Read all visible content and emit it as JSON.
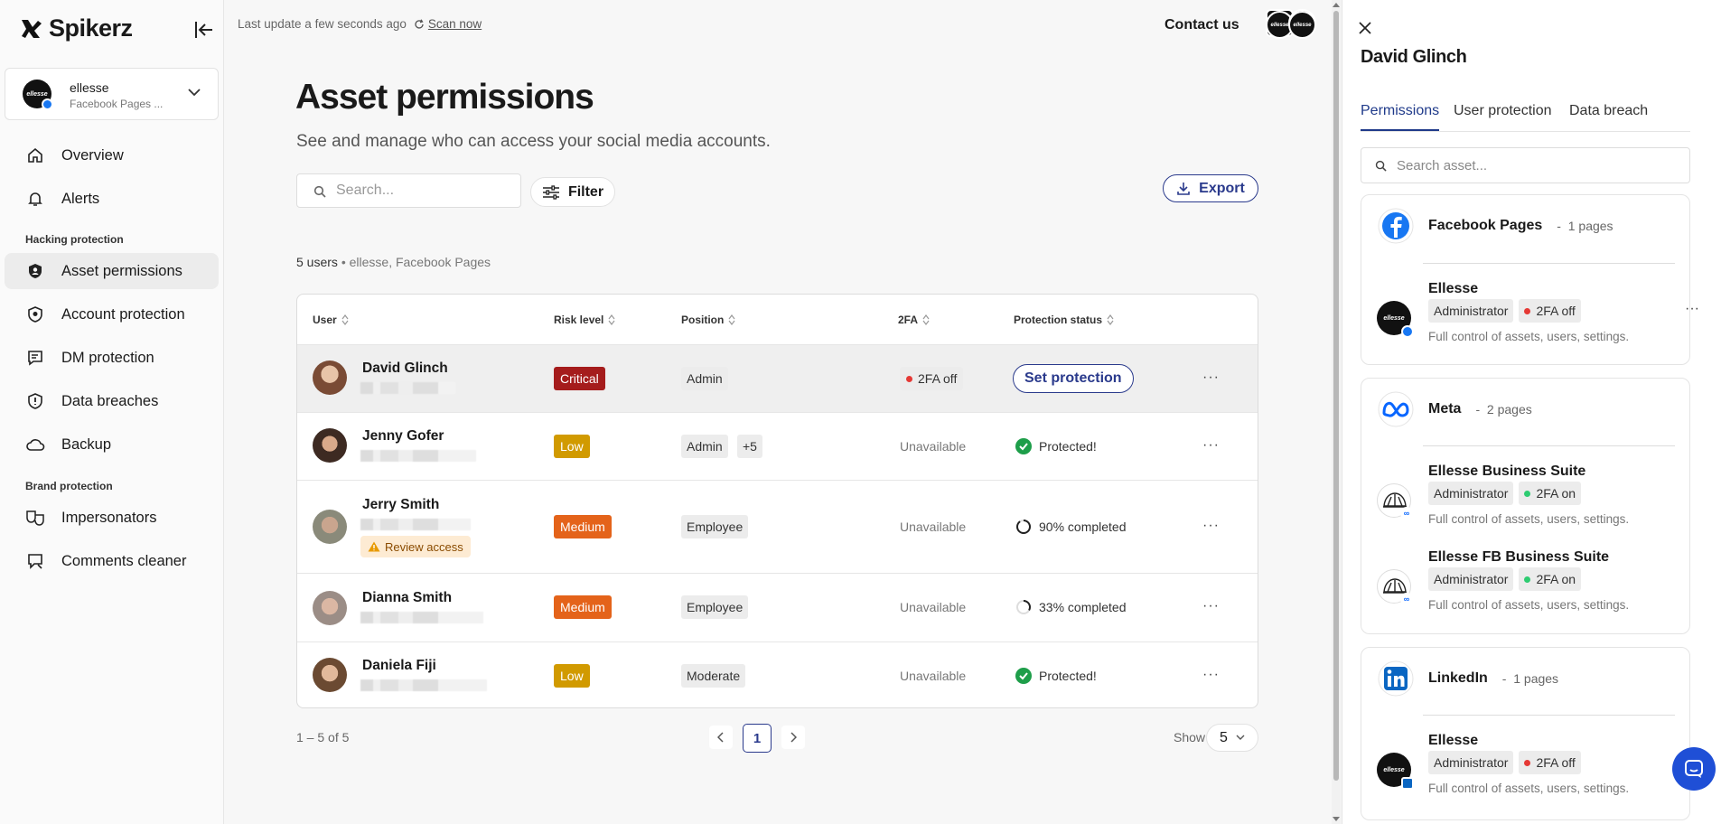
{
  "sidebar": {
    "brand": "Spikerz",
    "account": {
      "name": "ellesse",
      "subtitle": "Facebook Pages ...",
      "avatar_text": "ellesse"
    },
    "nav": [
      {
        "label": "Overview",
        "icon": "home-icon"
      },
      {
        "label": "Alerts",
        "icon": "bell-icon"
      }
    ],
    "section_hacking": "Hacking protection",
    "nav_hacking": [
      {
        "label": "Asset permissions",
        "icon": "shield-user-icon",
        "active": true
      },
      {
        "label": "Account protection",
        "icon": "shield-icon"
      },
      {
        "label": "DM protection",
        "icon": "message-icon"
      },
      {
        "label": "Data breaches",
        "icon": "shield-alert-icon"
      },
      {
        "label": "Backup",
        "icon": "cloud-icon"
      }
    ],
    "section_brand": "Brand protection",
    "nav_brand": [
      {
        "label": "Impersonators",
        "icon": "masks-icon"
      },
      {
        "label": "Comments cleaner",
        "icon": "comment-icon"
      }
    ]
  },
  "topbar": {
    "last_update": "Last update a few seconds ago",
    "scan_now": "Scan now",
    "contact": "Contact us"
  },
  "page": {
    "title": "Asset permissions",
    "subtitle": "See and manage who can access your social media accounts.",
    "search_placeholder": "Search...",
    "filter_label": "Filter",
    "export_label": "Export",
    "count_users": "5 users",
    "count_context": "ellesse, Facebook Pages"
  },
  "table": {
    "columns": [
      "User",
      "Risk level",
      "Position",
      "2FA",
      "Protection status"
    ],
    "rows": [
      {
        "name": "David Glinch",
        "risk": "Critical",
        "risk_color": "#a51c1c",
        "position": "Admin",
        "position_extra": "",
        "twofa": "2FA off",
        "status": "Set protection",
        "status_type": "action",
        "review": ""
      },
      {
        "name": "Jenny Gofer",
        "risk": "Low",
        "risk_color": "#d19a00",
        "position": "Admin",
        "position_extra": "+5",
        "twofa": "Unavailable",
        "status": "Protected!",
        "status_type": "protected",
        "review": ""
      },
      {
        "name": "Jerry Smith",
        "risk": "Medium",
        "risk_color": "#e4631a",
        "position": "Employee",
        "position_extra": "",
        "twofa": "Unavailable",
        "status": "90% completed",
        "status_type": "progress",
        "progress": 0.9,
        "review": "Review access"
      },
      {
        "name": "Dianna Smith",
        "risk": "Medium",
        "risk_color": "#e4631a",
        "position": "Employee",
        "position_extra": "",
        "twofa": "Unavailable",
        "status": "33% completed",
        "status_type": "progress",
        "progress": 0.33,
        "review": ""
      },
      {
        "name": "Daniela Fiji",
        "risk": "Low",
        "risk_color": "#d19a00",
        "position": "Moderate",
        "position_extra": "",
        "twofa": "Unavailable",
        "status": "Protected!",
        "status_type": "protected",
        "review": ""
      }
    ]
  },
  "pagination": {
    "range": "1 – 5 of 5",
    "current": "1",
    "show_label": "Show",
    "show_value": "5"
  },
  "panel": {
    "title": "David Glinch",
    "tabs": [
      "Permissions",
      "User protection",
      "Data breach"
    ],
    "active_tab": "Permissions",
    "search_placeholder": "Search asset...",
    "groups": [
      {
        "name": "Facebook Pages",
        "count": "1 pages",
        "icon": "facebook-icon",
        "assets": [
          {
            "name": "Ellesse",
            "role": "Administrator",
            "twofa": "2FA off",
            "twofa_on": false,
            "desc": "Full control of assets, users, settings."
          }
        ]
      },
      {
        "name": "Meta",
        "count": "2 pages",
        "icon": "meta-icon",
        "assets": [
          {
            "name": "Ellesse Business Suite",
            "role": "Administrator",
            "twofa": "2FA on",
            "twofa_on": true,
            "desc": "Full control of assets, users, settings."
          },
          {
            "name": "Ellesse FB Business Suite",
            "role": "Administrator",
            "twofa": "2FA on",
            "twofa_on": true,
            "desc": "Full control of assets, users, settings."
          }
        ]
      },
      {
        "name": "LinkedIn",
        "count": "1 pages",
        "icon": "linkedin-icon",
        "assets": [
          {
            "name": "Ellesse",
            "role": "Administrator",
            "twofa": "2FA off",
            "twofa_on": false,
            "desc": "Full control of assets, users, settings."
          }
        ]
      }
    ]
  },
  "colors": {
    "accent": "#2a3a8c",
    "twofa_off": "#e53935",
    "twofa_on": "#2ecc71",
    "protected": "#1e9e4a"
  }
}
